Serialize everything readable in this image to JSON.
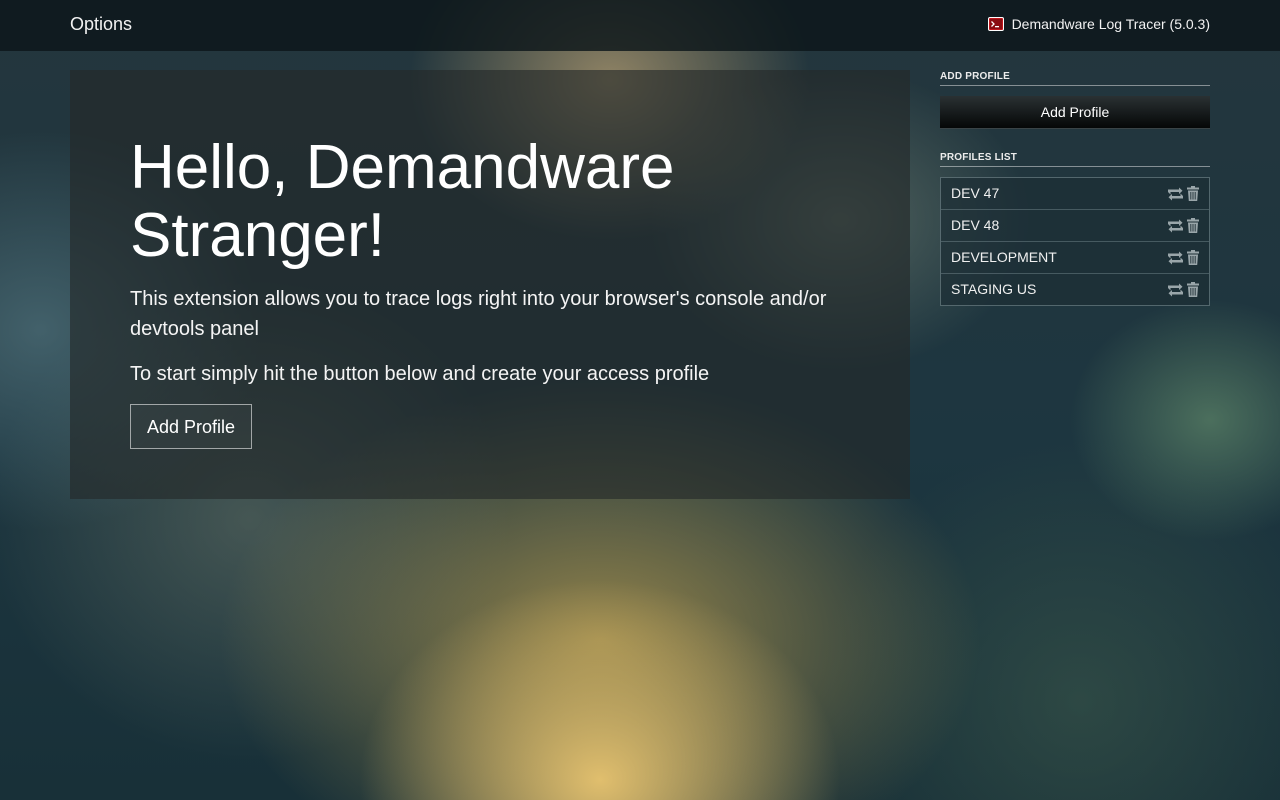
{
  "topbar": {
    "title": "Options",
    "app_name": "Demandware Log Tracer (5.0.3)",
    "app_icon": "terminal-icon"
  },
  "hero": {
    "heading": "Hello, Demandware Stranger!",
    "description": "This extension allows you to trace logs right into your browser's console and/or devtools panel",
    "instruction": "To start simply hit the button below and create your access profile",
    "button_label": "Add Profile"
  },
  "sidebar": {
    "add_section_title": "ADD PROFILE",
    "add_button_label": "Add Profile",
    "profiles_section_title": "PROFILES LIST",
    "profiles": [
      {
        "name": "DEV 47",
        "actions": [
          "retweet-icon",
          "trash-icon"
        ]
      },
      {
        "name": "DEV 48",
        "actions": [
          "retweet-icon",
          "trash-icon"
        ]
      },
      {
        "name": "DEVELOPMENT",
        "actions": [
          "retweet-icon",
          "trash-icon"
        ]
      },
      {
        "name": "STAGING US",
        "actions": [
          "retweet-icon",
          "trash-icon"
        ]
      }
    ]
  },
  "colors": {
    "icon_accent": "#c0161c",
    "action_icon": "#9aa6aa"
  }
}
